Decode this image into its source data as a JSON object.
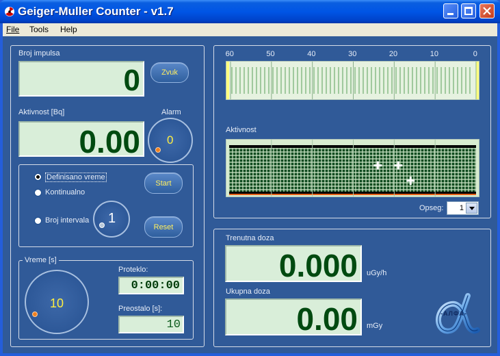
{
  "window": {
    "title": "Geiger-Muller Counter - v1.7"
  },
  "menu": [
    "File",
    "Tools",
    "Help"
  ],
  "counter": {
    "label": "Broj impulsa",
    "value": "0",
    "sound_button": "Zvuk"
  },
  "activity": {
    "label": "Aktivnost [Bq]",
    "value": "0.00",
    "alarm_label": "Alarm",
    "alarm_value": "0"
  },
  "mode": {
    "options": [
      "Definisano vreme",
      "Kontinualno",
      "Broj intervala"
    ],
    "selected": "Definisano vreme",
    "intervals_value": "1",
    "start_button": "Start",
    "reset_button": "Reset"
  },
  "time": {
    "group_label": "Vreme [s]",
    "knob_value": "10",
    "elapsed_label": "Proteklo:",
    "elapsed_value": "0:00:00",
    "remaining_label": "Preostalo [s]:",
    "remaining_value": "10"
  },
  "scale": {
    "ticks": [
      "60",
      "50",
      "40",
      "30",
      "20",
      "10",
      "0"
    ],
    "graph_label": "Aktivnost",
    "range_label": "Opseg:",
    "range_value": "1",
    "markers": [
      {
        "t": 24,
        "row": 0.4
      },
      {
        "t": 19,
        "row": 0.4
      },
      {
        "t": 16,
        "row": 0.75
      }
    ]
  },
  "dose": {
    "current_label": "Trenutna doza",
    "current_value": "0.000",
    "current_unit": "uGy/h",
    "total_label": "Ukupna doza",
    "total_value": "0.00",
    "total_unit": "mGy",
    "logo_text": "-АЛФА-"
  },
  "colors": {
    "accent_bar": "#ffff80",
    "lcd_bg": "#d9eed9",
    "digit": "#004a10",
    "knob_dot": "#f08020"
  }
}
